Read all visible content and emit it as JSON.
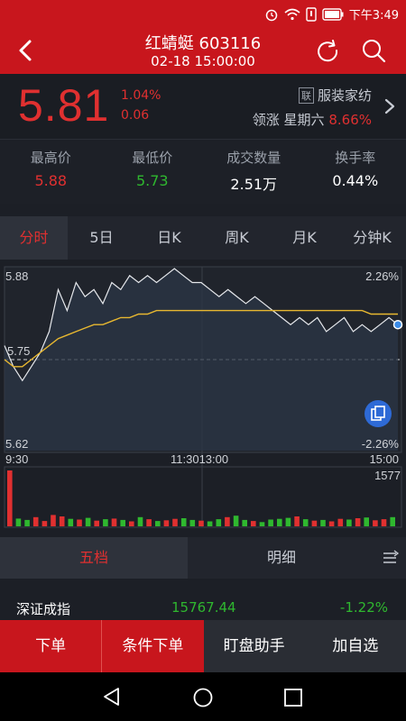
{
  "status": {
    "time": "下午3:49"
  },
  "header": {
    "title": "红蜻蜓 603116",
    "subtitle": "02-18 15:00:00"
  },
  "quote": {
    "price": "5.81",
    "change_pct": "1.04%",
    "change": "0.06",
    "sector_tag": "联",
    "sector": "服装家纺",
    "leader_prefix": "领涨 星期六",
    "leader_pct": "8.66%"
  },
  "stats": [
    {
      "label": "最高价",
      "value": "5.88",
      "color": "#e03030"
    },
    {
      "label": "最低价",
      "value": "5.73",
      "color": "#2fb82f"
    },
    {
      "label": "成交数量",
      "value": "2.51万",
      "color": "#ffffff"
    },
    {
      "label": "换手率",
      "value": "0.44%",
      "color": "#ffffff"
    }
  ],
  "tabs": [
    "分时",
    "5日",
    "日K",
    "周K",
    "月K",
    "分钟K"
  ],
  "chart_labels": {
    "y_top": "5.88",
    "y_mid": "5.75",
    "y_bottom": "5.62",
    "pct_top": "2.26%",
    "pct_bottom": "-2.26%",
    "t_start": "9:30",
    "t_mid": "11:3013:00",
    "t_end": "15:00",
    "vol_max": "1577"
  },
  "chart_data": {
    "type": "line",
    "title": "",
    "ylim": [
      5.62,
      5.88
    ],
    "x_ticks": [
      "9:30",
      "11:30/13:00",
      "15:00"
    ],
    "series": [
      {
        "name": "",
        "color": "#ffffff",
        "values": [
          5.77,
          5.74,
          5.72,
          5.74,
          5.76,
          5.79,
          5.85,
          5.82,
          5.86,
          5.84,
          5.85,
          5.83,
          5.86,
          5.85,
          5.87,
          5.86,
          5.87,
          5.86,
          5.87,
          5.88,
          5.87,
          5.86,
          5.86,
          5.85,
          5.84,
          5.85,
          5.84,
          5.83,
          5.84,
          5.83,
          5.82,
          5.81,
          5.8,
          5.81,
          5.8,
          5.81,
          5.79,
          5.8,
          5.81,
          5.79,
          5.8,
          5.79,
          5.8,
          5.81,
          5.8
        ]
      },
      {
        "name": "",
        "color": "#e8b830",
        "values": [
          5.75,
          5.74,
          5.74,
          5.75,
          5.76,
          5.77,
          5.78,
          5.785,
          5.79,
          5.795,
          5.8,
          5.8,
          5.805,
          5.81,
          5.81,
          5.815,
          5.815,
          5.82,
          5.82,
          5.82,
          5.82,
          5.82,
          5.82,
          5.82,
          5.82,
          5.82,
          5.82,
          5.82,
          5.82,
          5.82,
          5.82,
          5.82,
          5.82,
          5.82,
          5.82,
          5.82,
          5.82,
          5.82,
          5.82,
          5.82,
          5.82,
          5.815,
          5.815,
          5.815,
          5.815
        ]
      }
    ],
    "baseline": 5.75,
    "volume": [
      1577,
      220,
      180,
      260,
      150,
      320,
      280,
      210,
      190,
      240,
      160,
      200,
      220,
      180,
      140,
      260,
      200,
      150,
      170,
      210,
      230,
      180,
      160,
      140,
      200,
      260,
      300,
      180,
      150,
      120,
      190,
      210,
      240,
      280,
      200,
      160,
      180,
      140,
      210,
      190,
      230,
      250,
      170,
      200,
      260
    ]
  },
  "book_tabs": {
    "left": "五档",
    "right": "明细"
  },
  "index": {
    "name": "深证成指",
    "value": "15767.44",
    "change": "-1.22%"
  },
  "bottom_actions": [
    "下单",
    "条件下单",
    "盯盘助手",
    "加自选"
  ]
}
